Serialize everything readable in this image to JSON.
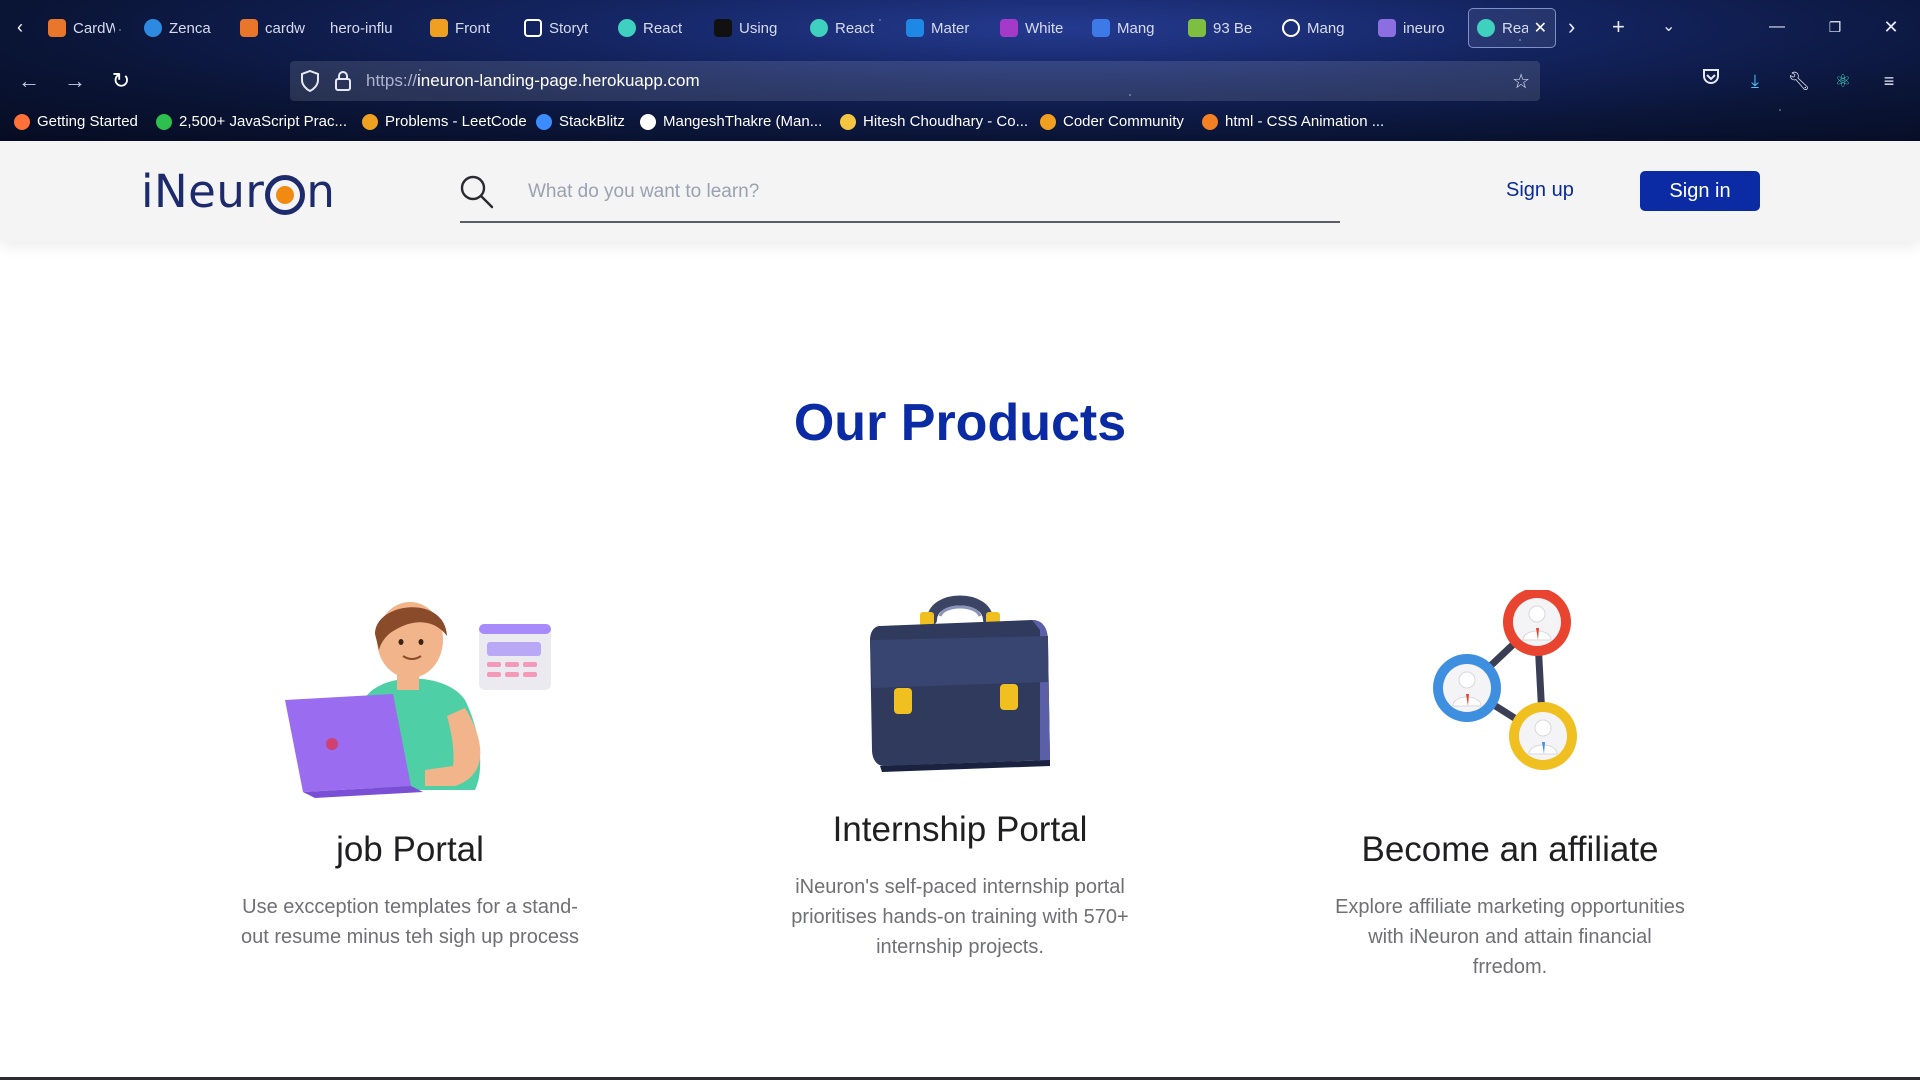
{
  "browser": {
    "tabs": [
      {
        "label": "CardW",
        "icon": "codersrank-fox-icon",
        "color": "#e8762b"
      },
      {
        "label": "Zenca",
        "icon": "zencastr-globe-icon",
        "color": "#2c8be0"
      },
      {
        "label": "cardw",
        "icon": "codersrank-fox-icon",
        "color": "#e8762b"
      },
      {
        "label": "hero-influ",
        "icon": "",
        "color": ""
      },
      {
        "label": "Front",
        "icon": "codepen-braces-icon",
        "color": "#f0a020"
      },
      {
        "label": "Storyt",
        "icon": "sparkle-icon",
        "color": "#ffffff"
      },
      {
        "label": "React",
        "icon": "react-icon",
        "color": "#3fd0c0"
      },
      {
        "label": "Using",
        "icon": "medium-m-icon",
        "color": "#111111"
      },
      {
        "label": "React",
        "icon": "react-icon",
        "color": "#3fd0c0"
      },
      {
        "label": "Mater",
        "icon": "mui-icon",
        "color": "#1e88e5"
      },
      {
        "label": "White",
        "icon": "drop-icon",
        "color": "#a53ac8"
      },
      {
        "label": "Mang",
        "icon": "code-brackets-icon",
        "color": "#3e79e8"
      },
      {
        "label": "93 Be",
        "icon": "cursor-icon",
        "color": "#7fbf3f"
      },
      {
        "label": "Mang",
        "icon": "github-icon",
        "color": "#ffffff"
      },
      {
        "label": "ineuro",
        "icon": "heroku-icon",
        "color": "#8d6ee0"
      },
      {
        "label": "Rea",
        "icon": "react-icon",
        "color": "#3fd0c0",
        "active": true
      }
    ],
    "url_protocol": "https://",
    "url_host": "ineuron-landing-page.herokuapp.com",
    "bookmarks": [
      {
        "label": "Getting Started",
        "color": "#ff7139"
      },
      {
        "label": "2,500+ JavaScript Prac...",
        "color": "#2fbf4f"
      },
      {
        "label": "Problems - LeetCode",
        "color": "#f0a020"
      },
      {
        "label": "StackBlitz",
        "color": "#3b8cff"
      },
      {
        "label": "MangeshThakre (Man...",
        "color": "#ffffff"
      },
      {
        "label": "Hitesh Choudhary - Co...",
        "color": "#f5c542"
      },
      {
        "label": "Coder Community",
        "color": "#f0a020"
      },
      {
        "label": "html - CSS Animation ...",
        "color": "#f48024"
      }
    ]
  },
  "header": {
    "logo_left": "iNeur",
    "logo_right": "n",
    "search_placeholder": "What do you want to learn?",
    "signup_label": "Sign up",
    "signin_label": "Sign in"
  },
  "main": {
    "section_title": "Our Products",
    "products": [
      {
        "title": "job Portal",
        "description": "Use excception templates for a stand-out resume minus teh sigh up process",
        "illustration": "person-with-laptop-illustration"
      },
      {
        "title": "Internship Portal",
        "description": "iNeuron's self-paced internship portal prioritises hands-on training with 570+ internship projects.",
        "illustration": "briefcase-illustration"
      },
      {
        "title": "Become an affiliate",
        "description": "Explore affiliate marketing opportunities with iNeuron and attain financial frredom.",
        "illustration": "network-people-illustration"
      }
    ]
  },
  "colors": {
    "brand_blue": "#0a2ba3",
    "logo_navy": "#1d2a6b",
    "logo_orange": "#f08a10",
    "text_dark": "#1f1f22",
    "text_muted": "#6f6f76"
  }
}
